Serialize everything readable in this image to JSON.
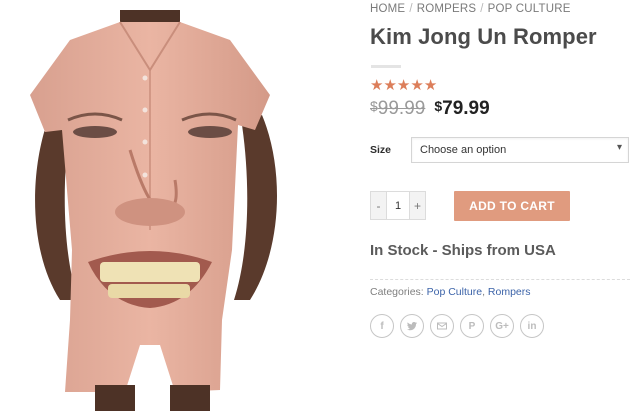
{
  "breadcrumb": {
    "home": "HOME",
    "sep": "/",
    "cat1": "ROMPERS",
    "cat2": "POP CULTURE"
  },
  "product": {
    "title": "Kim Jong Un Romper",
    "rating": 5,
    "old_price_symbol": "$",
    "old_price_value": "99.99",
    "new_price_symbol": "$",
    "new_price_value": "79.99"
  },
  "variation": {
    "label": "Size",
    "selected": "Choose an option"
  },
  "quantity": {
    "value": "1",
    "minus": "-",
    "plus": "+"
  },
  "cart": {
    "add_label": "ADD TO CART"
  },
  "stock": {
    "text": "In Stock - Ships from USA"
  },
  "categories": {
    "label": "Categories:",
    "items": [
      "Pop Culture",
      "Rompers"
    ],
    "sep": ","
  },
  "share": {
    "icons": [
      "facebook-icon",
      "twitter-icon",
      "email-icon",
      "pinterest-icon",
      "google-plus-icon",
      "linkedin-icon"
    ]
  },
  "colors": {
    "accent": "#e09b7f",
    "stars": "#dc7e5a",
    "link": "#3d64a9"
  }
}
